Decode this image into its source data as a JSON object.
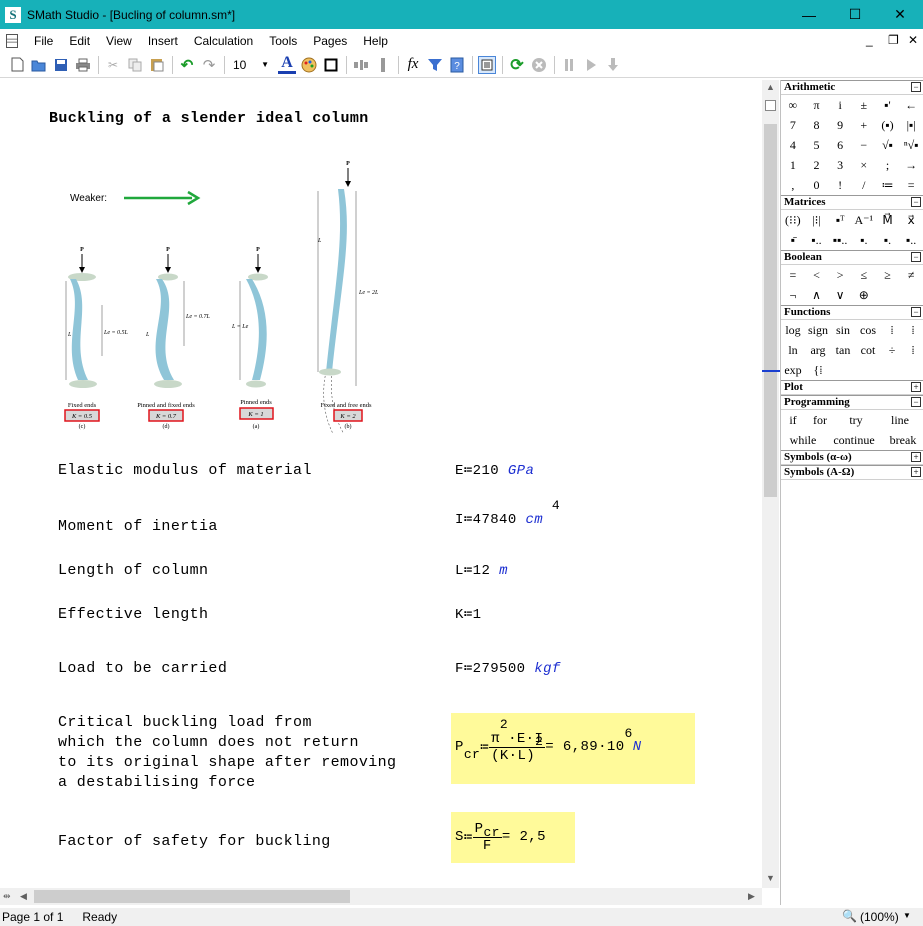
{
  "window": {
    "title": "SMath Studio - [Bucling of column.sm*]",
    "app_icon": "S",
    "minimize": "—",
    "maximize": "☐",
    "close": "✕",
    "mdi_minimize": "_",
    "mdi_restore": "🗗",
    "mdi_close": "✕"
  },
  "menu": [
    "File",
    "Edit",
    "View",
    "Insert",
    "Calculation",
    "Tools",
    "Pages",
    "Help"
  ],
  "toolbar": {
    "font_size": "10",
    "icons": [
      "new-icon",
      "open-icon",
      "save-icon",
      "print-icon",
      "cut-icon",
      "copy-icon",
      "paste-icon",
      "undo-icon",
      "redo-icon",
      "font-color-icon",
      "palette-icon",
      "border-icon",
      "align-icon",
      "filter-icon",
      "help-icon",
      "page-view-icon",
      "calculate-icon",
      "stop-icon",
      "pause-icon",
      "play-icon",
      "step-icon"
    ],
    "fx_label": "fx"
  },
  "sheet": {
    "title": "Buckling of a slender ideal column",
    "figure": {
      "weaker": "Weaker:",
      "p": "P",
      "col_c_caption": "Fixed ends",
      "col_c_k": "K = 0.5",
      "col_c_letter": "(c)",
      "col_c_le": "Le = 0.5L",
      "col_d_caption": "Pinned and fixed ends",
      "col_d_k": "K = 0.7",
      "col_d_letter": "(d)",
      "col_d_le": "Le = 0.7L",
      "col_a_caption": "Pinned ends",
      "col_a_k": "K = 1",
      "col_a_letter": "(a)",
      "col_a_le": "L = Le",
      "col_b_caption": "Fixed and free ends",
      "col_b_k": "K = 2",
      "col_b_letter": "(b)",
      "col_b_le": "Le = 2L",
      "L": "L"
    },
    "rows": [
      {
        "label": "Elastic modulus of material",
        "var": "E",
        "assign": "≔",
        "value": "210",
        "unit": "GPa"
      },
      {
        "label": "Moment of inertia",
        "var": "I",
        "assign": "≔",
        "value": "47840",
        "unit": "cm",
        "exp": "4"
      },
      {
        "label": "Length of column",
        "var": "L",
        "assign": "≔",
        "value": "12",
        "unit": "m"
      },
      {
        "label": "Effective length",
        "var": "K",
        "assign": "≔",
        "value": "1"
      },
      {
        "label": "Load to be carried",
        "var": "F",
        "assign": "≔",
        "value": "279500",
        "unit": "kgf"
      }
    ],
    "critical": {
      "label_lines": [
        "Critical buckling load from",
        "which the column does not return",
        "to its original shape after removing",
        "a destabilising force"
      ],
      "var": "P",
      "sub": "cr",
      "assign": "≔",
      "num": "π",
      "num_exp": "2",
      "num_rest": "·E·I",
      "den": "(K·L)",
      "den_exp": "2",
      "result": "= 6,89·10",
      "result_exp": "6",
      "unit": "N"
    },
    "safety": {
      "label": "Factor of safety for buckling",
      "var": "S",
      "assign": "≔",
      "num": "P",
      "num_sub": "cr",
      "den": "F",
      "result": "= 2,5"
    }
  },
  "panel": {
    "arithmetic": {
      "title": "Arithmetic",
      "toggle": "−",
      "cells": [
        "∞",
        "π",
        "i",
        "±",
        "▪'",
        "←",
        "7",
        "8",
        "9",
        "+",
        "(▪)",
        "|▪|",
        "4",
        "5",
        "6",
        "−",
        "√▪",
        "ⁿ√▪",
        "1",
        "2",
        "3",
        "×",
        ";",
        "→",
        ",",
        "0",
        "!",
        "/",
        "≔",
        "="
      ]
    },
    "matrices": {
      "title": "Matrices",
      "toggle": "−",
      "cells": [
        "(⁝⁝)",
        "|⁝|",
        "▪ᵀ",
        "A⁻¹",
        "M⃗",
        "x⃗",
        "▪̄",
        "▪..",
        "▪▪..",
        "▪.",
        "▪.",
        "▪.."
      ]
    },
    "boolean": {
      "title": "Boolean",
      "toggle": "−",
      "cells": [
        "=",
        "<",
        ">",
        "≤",
        "≥",
        "≠",
        "¬",
        "∧",
        "∨",
        "⊕"
      ]
    },
    "functions": {
      "title": "Functions",
      "toggle": "−",
      "row1": [
        "log",
        "sign",
        "sin",
        "cos",
        "⁞",
        "⁞"
      ],
      "row2": [
        "ln",
        "arg",
        "tan",
        "cot",
        "÷",
        "⁞"
      ],
      "row3": [
        "exp",
        "{⁞"
      ]
    },
    "plot": {
      "title": "Plot",
      "toggle": "+"
    },
    "programming": {
      "title": "Programming",
      "toggle": "−",
      "row1": [
        "if",
        "for",
        "try",
        "line"
      ],
      "row2": [
        "while",
        "continue",
        "break"
      ]
    },
    "symbols_lower": {
      "title": "Symbols (α-ω)",
      "toggle": "+"
    },
    "symbols_upper": {
      "title": "Symbols (Α-Ω)",
      "toggle": "+"
    }
  },
  "status": {
    "page": "Page 1 of 1",
    "state": "Ready",
    "zoom": "(100%)"
  },
  "colors": {
    "titlebar": "#17b1b9",
    "unit": "#1d2fd1",
    "highlight": "#fffa9a",
    "figure_column": "#8fc5d8",
    "k_box": "#e0141c",
    "arrow": "#20a83c"
  }
}
